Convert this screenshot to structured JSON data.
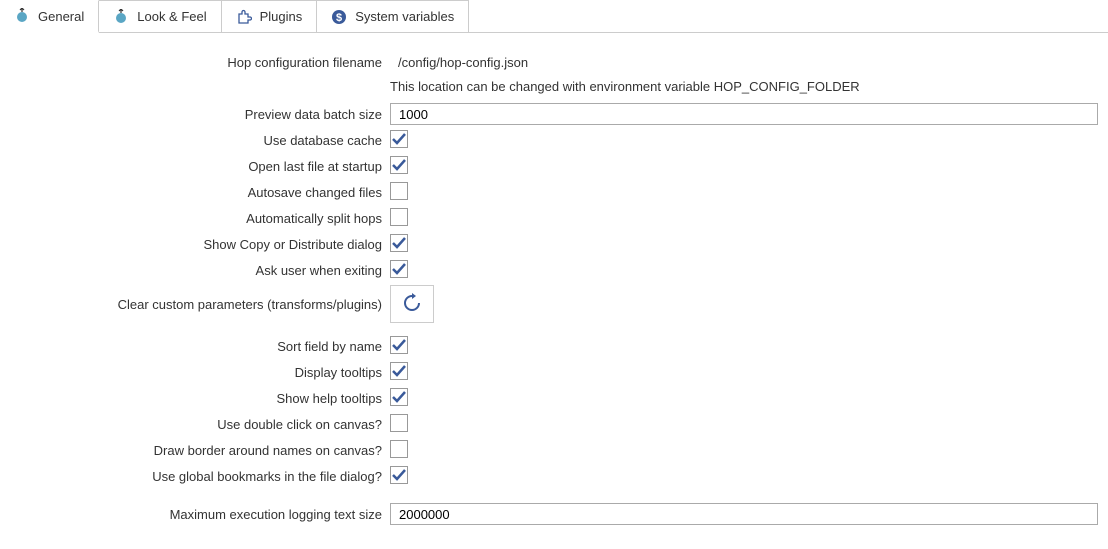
{
  "tabs": {
    "general": "General",
    "look_feel": "Look & Feel",
    "plugins": "Plugins",
    "system_vars": "System variables"
  },
  "fields": {
    "config_filename_label": "Hop configuration filename",
    "config_filename_value": "/config/hop-config.json",
    "config_hint": "This location can be changed with environment variable HOP_CONFIG_FOLDER",
    "preview_batch_label": "Preview data batch size",
    "preview_batch_value": "1000",
    "use_db_cache_label": "Use database cache",
    "use_db_cache_checked": true,
    "open_last_label": "Open last file at startup",
    "open_last_checked": true,
    "autosave_label": "Autosave changed files",
    "autosave_checked": false,
    "auto_split_label": "Automatically split hops",
    "auto_split_checked": false,
    "show_copy_label": "Show Copy or Distribute dialog",
    "show_copy_checked": true,
    "ask_exit_label": "Ask user when exiting",
    "ask_exit_checked": true,
    "clear_params_label": "Clear custom parameters (transforms/plugins)",
    "sort_field_label": "Sort field by name",
    "sort_field_checked": true,
    "display_tooltips_label": "Display tooltips",
    "display_tooltips_checked": true,
    "show_help_label": "Show help tooltips",
    "show_help_checked": true,
    "double_click_label": "Use double click on canvas?",
    "double_click_checked": false,
    "draw_border_label": "Draw border around names on canvas?",
    "draw_border_checked": false,
    "global_bookmarks_label": "Use global bookmarks in the file dialog?",
    "global_bookmarks_checked": true,
    "max_logging_label": "Maximum execution logging text size",
    "max_logging_value": "2000000"
  }
}
